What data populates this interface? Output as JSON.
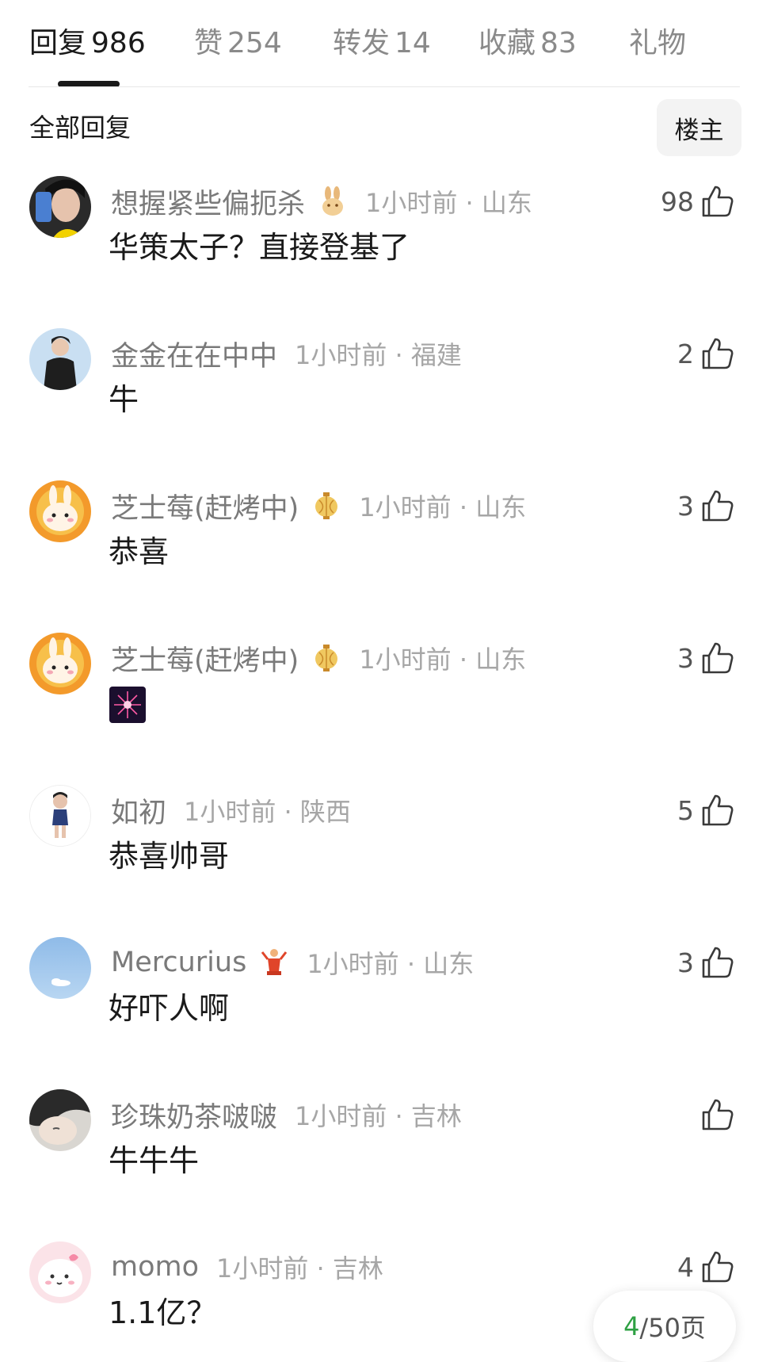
{
  "tabs": [
    {
      "label": "回复",
      "count": "986"
    },
    {
      "label": "赞",
      "count": "254"
    },
    {
      "label": "转发",
      "count": "14"
    },
    {
      "label": "收藏",
      "count": "83"
    },
    {
      "label": "礼物",
      "count": ""
    }
  ],
  "filter": {
    "label": "全部回复",
    "author_only": "楼主"
  },
  "comments": [
    {
      "user": "想握紧些偏扼杀",
      "time": "1小时前 · 山东",
      "text": "华策太子？直接登基了",
      "likes": "98",
      "badge": "rabbit-badge-icon"
    },
    {
      "user": "金金在在中中",
      "time": "1小时前 · 福建",
      "text": "牛",
      "likes": "2",
      "badge": ""
    },
    {
      "user": "芝士莓(赶烤中)",
      "time": "1小时前 · 山东",
      "text": "恭喜",
      "likes": "3",
      "badge": "lantern-badge-icon"
    },
    {
      "user": "芝士莓(赶烤中)",
      "time": "1小时前 · 山东",
      "text": "",
      "likes": "3",
      "badge": "lantern-badge-icon",
      "sticker": "firework-sticker-icon"
    },
    {
      "user": "如初",
      "time": "1小时前 · 陕西",
      "text": "恭喜帅哥",
      "likes": "5",
      "badge": ""
    },
    {
      "user": "Mercurius",
      "time": "1小时前 · 山东",
      "text": "好吓人啊",
      "likes": "3",
      "badge": "dancer-badge-icon"
    },
    {
      "user": "珍珠奶茶啵啵",
      "time": "1小时前 · 吉林",
      "text": "牛牛牛",
      "likes": "",
      "badge": ""
    },
    {
      "user": "momo",
      "time": "1小时前 · 吉林",
      "text": "1.1亿？",
      "likes": "4",
      "badge": ""
    }
  ],
  "pager": {
    "current": "4",
    "total_text": "/50页"
  },
  "colors": {
    "accent_green": "#2ea043",
    "text_gray": "#7a7a7a",
    "time_gray": "#a6a6a6"
  }
}
